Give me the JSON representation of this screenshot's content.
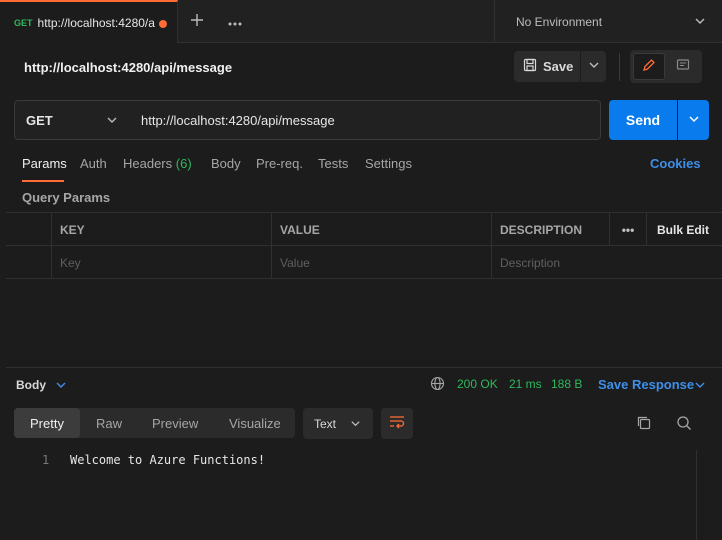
{
  "tab": {
    "method": "GET",
    "url": "http://localhost:4280/a"
  },
  "environment": "No Environment",
  "request": {
    "title": "http://localhost:4280/api/message",
    "save_label": "Save",
    "method": "GET",
    "url": "http://localhost:4280/api/message",
    "send_label": "Send"
  },
  "request_tabs": {
    "params": "Params",
    "auth": "Auth",
    "headers": "Headers",
    "headers_count": "(6)",
    "body": "Body",
    "prereq": "Pre-req.",
    "tests": "Tests",
    "settings": "Settings",
    "cookies": "Cookies"
  },
  "query_params": {
    "label": "Query Params",
    "headers": {
      "key": "KEY",
      "value": "VALUE",
      "description": "DESCRIPTION",
      "more": "•••",
      "bulk_edit": "Bulk Edit"
    },
    "placeholders": {
      "key": "Key",
      "value": "Value",
      "description": "Description"
    }
  },
  "response": {
    "body_label": "Body",
    "status": "200 OK",
    "time": "21 ms",
    "size": "188 B",
    "save_response": "Save Response",
    "formats": [
      "Pretty",
      "Raw",
      "Preview",
      "Visualize"
    ],
    "language": "Text",
    "line_number": "1",
    "content": "Welcome to Azure Functions!"
  },
  "colors": {
    "accent": "#ff6c37",
    "send": "#097bed",
    "success": "#2fb85c",
    "link": "#3d8fe8"
  }
}
